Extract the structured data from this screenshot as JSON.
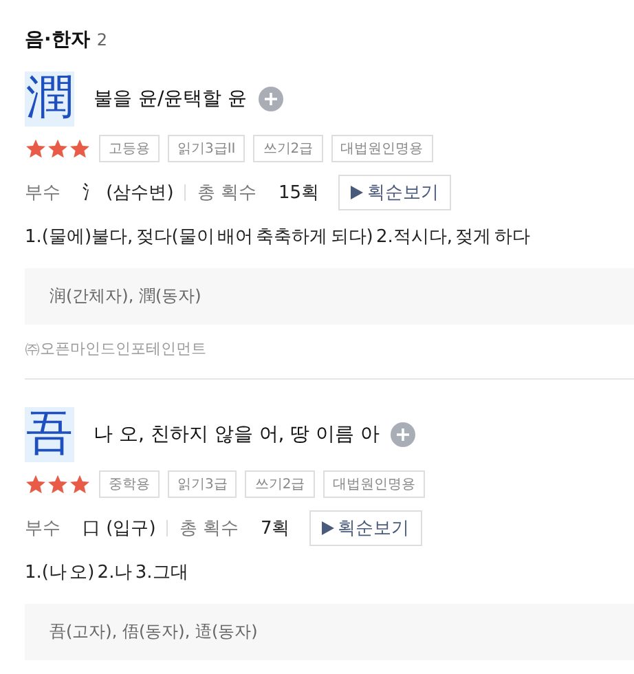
{
  "section": {
    "title": "음·한자",
    "count": "2"
  },
  "entries": [
    {
      "hanja": "潤",
      "reading": "불을 윤/윤택할 윤",
      "stars": 3,
      "tags": [
        "고등용",
        "읽기3급II",
        "쓰기2급",
        "대법원인명용"
      ],
      "radical_label": "부수",
      "radical": "氵",
      "radical_name": "(삼수변)",
      "strokes_label": "총 획수",
      "strokes": "15획",
      "stroke_button": "획순보기",
      "meaning": "1.(물에)불다, 젖다(물이 배어 축축하게 되다)  2.적시다, 젖게 하다",
      "variants": "润(간체자), 潤(동자)",
      "source": "㈜오픈마인드인포테인먼트"
    },
    {
      "hanja": "吾",
      "reading": "나 오, 친하지 않을 어, 땅 이름 아",
      "stars": 3,
      "tags": [
        "중학용",
        "읽기3급",
        "쓰기2급",
        "대법원인명용"
      ],
      "radical_label": "부수",
      "radical": "口",
      "radical_name": "(입구)",
      "strokes_label": "총 획수",
      "strokes": "7획",
      "stroke_button": "획순보기",
      "meaning": "1.(나 오)  2.나  3.그대",
      "variants": "吾(고자), 俉(동자), 逜(동자)"
    }
  ]
}
